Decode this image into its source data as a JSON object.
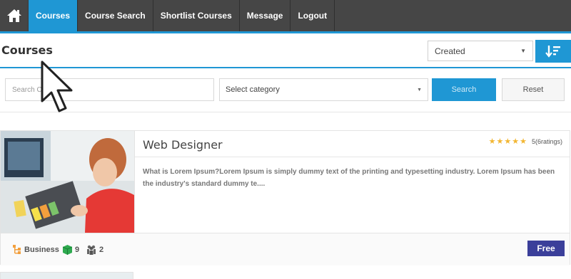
{
  "nav": {
    "items": [
      {
        "label": "Courses",
        "active": true
      },
      {
        "label": "Course Search",
        "active": false
      },
      {
        "label": "Shortlist Courses",
        "active": false
      },
      {
        "label": "Message",
        "active": false
      },
      {
        "label": "Logout",
        "active": false
      }
    ]
  },
  "page": {
    "title": "Courses",
    "sort_value": "Created"
  },
  "filters": {
    "search_placeholder": "Search Course",
    "category_value": "Select category",
    "search_label": "Search",
    "reset_label": "Reset"
  },
  "course": {
    "title": "Web Designer",
    "stars": 5,
    "rating_text": "5(6ratings)",
    "description": "What is Lorem Ipsum?Lorem Ipsum is simply dummy text of the printing and typesetting industry. Lorem Ipsum has been the industry's standard dummy te....",
    "category": "Business",
    "lessons": "9",
    "students": "2",
    "price": "Free"
  },
  "colors": {
    "accent": "#1f97d4",
    "nav_bg": "#464646",
    "price_badge": "#3b3f9a",
    "star": "#f2b632"
  },
  "icons": [
    "home-icon",
    "sort-icon",
    "category-icon",
    "lessons-icon",
    "students-icon",
    "star-icon"
  ]
}
